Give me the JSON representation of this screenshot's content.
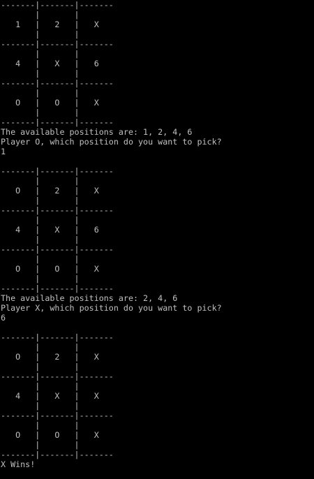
{
  "console": {
    "lines": [
      "-------|-------|-------",
      "       |       |       ",
      "   1   |   2   |   X   ",
      "       |       |       ",
      "-------|-------|-------",
      "       |       |       ",
      "   4   |   X   |   6   ",
      "       |       |       ",
      "-------|-------|-------",
      "       |       |       ",
      "   O   |   O   |   X   ",
      "       |       |       ",
      "-------|-------|-------",
      "The available positions are: 1, 2, 4, 6",
      "Player O, which position do you want to pick?",
      "1",
      "",
      "-------|-------|-------",
      "       |       |       ",
      "   O   |   2   |   X   ",
      "       |       |       ",
      "-------|-------|-------",
      "       |       |       ",
      "   4   |   X   |   6   ",
      "       |       |       ",
      "-------|-------|-------",
      "       |       |       ",
      "   O   |   O   |   X   ",
      "       |       |       ",
      "-------|-------|-------",
      "The available positions are: 2, 4, 6",
      "Player X, which position do you want to pick?",
      "6",
      "",
      "-------|-------|-------",
      "       |       |       ",
      "   O   |   2   |   X   ",
      "       |       |       ",
      "-------|-------|-------",
      "       |       |       ",
      "   4   |   X   |   X   ",
      "       |       |       ",
      "-------|-------|-------",
      "       |       |       ",
      "   O   |   O   |   X   ",
      "       |       |       ",
      "-------|-------|-------",
      "X Wins!"
    ]
  }
}
